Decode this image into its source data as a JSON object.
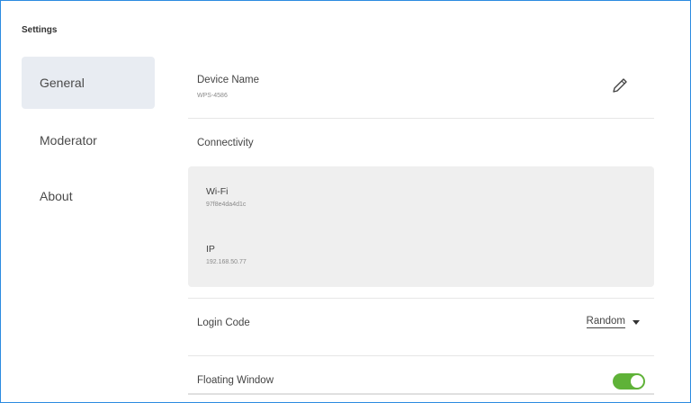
{
  "window": {
    "title": "Settings"
  },
  "sidebar": {
    "items": [
      {
        "label": "General",
        "active": true
      },
      {
        "label": "Moderator",
        "active": false
      },
      {
        "label": "About",
        "active": false
      }
    ]
  },
  "general": {
    "device_name": {
      "label": "Device Name",
      "value": "WPS-4586",
      "icon": "pencil-icon"
    },
    "connectivity": {
      "label": "Connectivity",
      "wifi": {
        "label": "Wi-Fi",
        "value": "97f8e4da4d1c"
      },
      "ip": {
        "label": "IP",
        "value": "192.168.50.77"
      }
    },
    "login_code": {
      "label": "Login Code",
      "value": "Random",
      "icon": "caret-down-icon"
    },
    "floating_window": {
      "label": "Floating Window",
      "enabled": true,
      "icon": "toggle-switch"
    }
  },
  "colors": {
    "accent_border": "#2c8be0",
    "toggle_on": "#5fb238",
    "active_nav_bg": "#e8ecf2"
  }
}
